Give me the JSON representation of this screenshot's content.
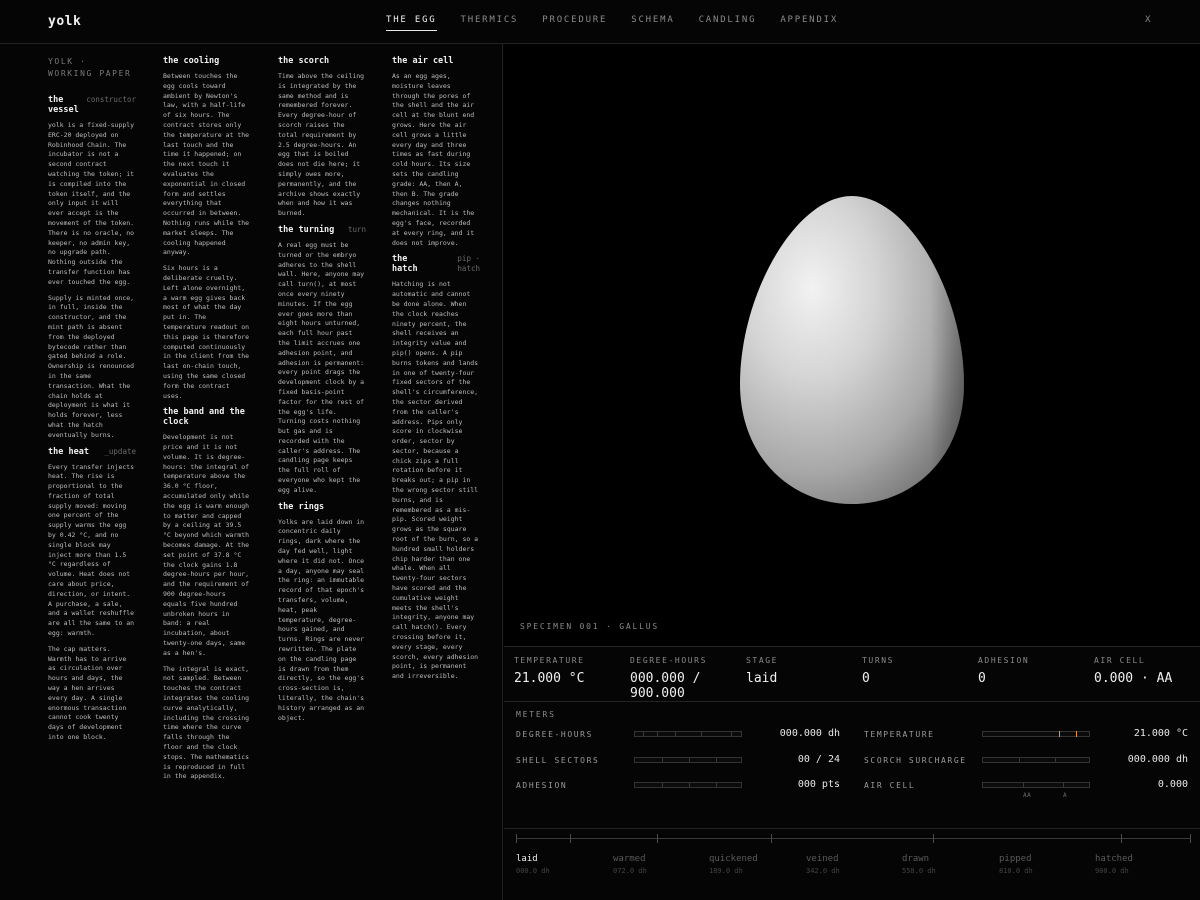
{
  "brand": "yolk",
  "nav": [
    {
      "label": "THE EGG",
      "active": true
    },
    {
      "label": "THERMICS",
      "active": false
    },
    {
      "label": "PROCEDURE",
      "active": false
    },
    {
      "label": "SCHEMA",
      "active": false
    },
    {
      "label": "CANDLING",
      "active": false
    },
    {
      "label": "APPENDIX",
      "active": false
    }
  ],
  "close_label": "X",
  "paper": {
    "kicker": "YOLK · WORKING PAPER",
    "vessel": {
      "title": "the vessel",
      "tag": "constructor",
      "p1": "yolk is a fixed-supply ERC-20 deployed on Robinhood Chain. The incubator is not a second contract watching the token; it is compiled into the token itself, and the only input it will ever accept is the movement of the token. There is no oracle, no keeper, no admin key, no upgrade path. Nothing outside the transfer function has ever touched the egg.",
      "p2": "Supply is minted once, in full, inside the constructor, and the mint path is absent from the deployed bytecode rather than gated behind a role. Ownership is renounced in the same transaction. What the chain holds at deployment is what it holds forever, less what the hatch eventually burns."
    },
    "heat": {
      "title": "the heat",
      "tag": "_update",
      "p1": "Every transfer injects heat. The rise is proportional to the fraction of total supply moved: moving one percent of the supply warms the egg by 0.42 °C, and no single block may inject more than 1.5 °C regardless of volume. Heat does not care about price, direction, or intent. A purchase, a sale, and a wallet reshuffle are all the same to an egg: warmth.",
      "p2": "The cap matters. Warmth has to arrive as circulation over hours and days, the way a hen arrives every day. A single enormous transaction cannot cook twenty days of development into one block."
    },
    "cooling": {
      "title": "the cooling",
      "p1": "Between touches the egg cools toward ambient by Newton's law, with a half-life of six hours. The contract stores only the temperature at the last touch and the time it happened; on the next touch it evaluates the exponential in closed form and settles everything that occurred in between. Nothing runs while the market sleeps. The cooling happened anyway.",
      "p2": "Six hours is a deliberate cruelty. Left alone overnight, a warm egg gives back most of what the day put in. The temperature readout on this page is therefore computed continuously in the client from the last on-chain touch, using the same closed form the contract uses."
    },
    "band": {
      "title": "the band and the clock",
      "p1": "Development is not price and it is not volume. It is degree-hours: the integral of temperature above the 36.0 °C floor, accumulated only while the egg is warm enough to matter and capped by a ceiling at 39.5 °C beyond which warmth becomes damage. At the set point of 37.8 °C the clock gains 1.8 degree-hours per hour, and the requirement of 900 degree-hours equals five hundred unbroken hours in band: a real incubation, about twenty-one days, same as a hen's.",
      "p2": "The integral is exact, not sampled. Between touches the contract integrates the cooling curve analytically, including the crossing time where the curve falls through the floor and the clock stops. The mathematics is reproduced in full in the appendix."
    },
    "scorch": {
      "title": "the scorch",
      "p1": "Time above the ceiling is integrated by the same method and is remembered forever. Every degree-hour of scorch raises the total requirement by 2.5 degree-hours. An egg that is boiled does not die here; it simply owes more, permanently, and the archive shows exactly when and how it was burned."
    },
    "turning": {
      "title": "the turning",
      "tag": "turn",
      "p1": "A real egg must be turned or the embryo adheres to the shell wall. Here, anyone may call turn(), at most once every ninety minutes. If the egg ever goes more than eight hours unturned, each full hour past the limit accrues one adhesion point, and adhesion is permanent: every point drags the development clock by a fixed basis-point factor for the rest of the egg's life. Turning costs nothing but gas and is recorded with the caller's address. The candling page keeps the full roll of everyone who kept the egg alive."
    },
    "rings": {
      "title": "the rings",
      "p1": "Yolks are laid down in concentric daily rings, dark where the day fed well, light where it did not. Once a day, anyone may seal the ring: an immutable record of that epoch's transfers, volume, heat, peak temperature, degree-hours gained, and turns. Rings are never rewritten. The plate on the candling page is drawn from them directly, so the egg's cross-section is, literally, the chain's history arranged as an object."
    },
    "aircell": {
      "title": "the air cell",
      "p1": "As an egg ages, moisture leaves through the pores of the shell and the air cell at the blunt end grows. Here the air cell grows a little every day and three times as fast during cold hours. Its size sets the candling grade: AA, then A, then B. The grade changes nothing mechanical. It is the egg's face, recorded at every ring, and it does not improve."
    },
    "hatch": {
      "title": "the hatch",
      "tag": "pip · hatch",
      "p1": "Hatching is not automatic and cannot be done alone. When the clock reaches ninety percent, the shell receives an integrity value and pip() opens. A pip burns tokens and lands in one of twenty-four fixed sectors of the shell's circumference, the sector derived from the caller's address. Pips only score in clockwise order, sector by sector, because a chick zips a full rotation before it breaks out; a pip in the wrong sector still burns, and is remembered as a mis-pip. Scored weight grows as the square root of the burn, so a hundred small holders chip harder than one whale. When all twenty-four sectors have scored and the cumulative weight meets the shell's integrity, anyone may call hatch(). Every crossing before it, every stage, every scorch, every adhesion point, is permanent and irreversible."
    }
  },
  "specimen": "SPECIMEN 001 · GALLUS",
  "readouts": [
    {
      "label": "TEMPERATURE",
      "value": "21.000 °C"
    },
    {
      "label": "DEGREE-HOURS",
      "value": "000.000 / 900.000"
    },
    {
      "label": "STAGE",
      "value": "laid"
    },
    {
      "label": "TURNS",
      "value": "0"
    },
    {
      "label": "ADHESION",
      "value": "0"
    },
    {
      "label": "AIR CELL",
      "value": "0.000 · AA"
    }
  ],
  "meters": {
    "title": "METERS",
    "degree_hours": {
      "label": "DEGREE-HOURS",
      "value": "000.000 dh"
    },
    "shell_sectors": {
      "label": "SHELL SECTORS",
      "value": "00 / 24"
    },
    "adhesion": {
      "label": "ADHESION",
      "value": "000 pts"
    },
    "temperature": {
      "label": "TEMPERATURE",
      "value": "21.000 °C"
    },
    "scorch": {
      "label": "SCORCH SURCHARGE",
      "value": "000.000 dh"
    },
    "air_cell": {
      "label": "AIR CELL",
      "value": "0.000"
    },
    "grade_marks": [
      "AA",
      "A"
    ]
  },
  "timeline": [
    {
      "name": "laid",
      "dh": "000.0 dh",
      "current": true
    },
    {
      "name": "warmed",
      "dh": "072.0 dh",
      "current": false
    },
    {
      "name": "quickened",
      "dh": "189.0 dh",
      "current": false
    },
    {
      "name": "veined",
      "dh": "342.0 dh",
      "current": false
    },
    {
      "name": "drawn",
      "dh": "558.0 dh",
      "current": false
    },
    {
      "name": "pipped",
      "dh": "810.0 dh",
      "current": false
    },
    {
      "name": "hatched",
      "dh": "900.0 dh",
      "current": false
    }
  ],
  "colors": {
    "accent": "#e09a3a",
    "background": "#050505",
    "text": "#d8d8d8"
  }
}
